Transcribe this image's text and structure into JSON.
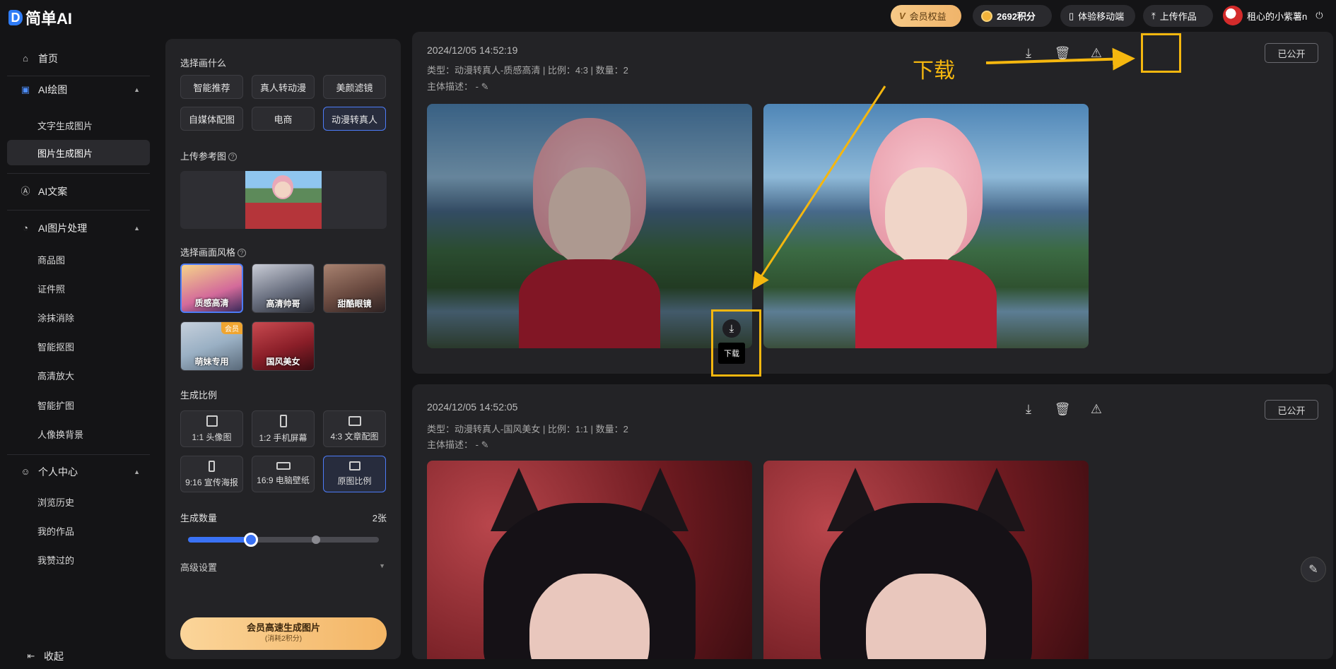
{
  "app": {
    "logo_mark": "D",
    "logo_text": "简单AI"
  },
  "topbar": {
    "vip_icon": "V",
    "vip_label": "会员权益",
    "points": "2692积分",
    "mobile": "体验移动端",
    "upload": "上传作品",
    "username": "租心的小紫薯n",
    "power_icon": "⏻"
  },
  "sidebar": {
    "home": "首页",
    "ai_draw": "AI绘图",
    "text_to_image": "文字生成图片",
    "image_to_image": "图片生成图片",
    "ai_copy": "AI文案",
    "ai_image_process": "AI图片处理",
    "process_items": [
      "商品图",
      "证件照",
      "涂抹消除",
      "智能抠图",
      "高清放大",
      "智能扩图",
      "人像换背景"
    ],
    "personal": "个人中心",
    "personal_items": [
      "浏览历史",
      "我的作品",
      "我赞过的"
    ],
    "collapse": "收起"
  },
  "panel": {
    "choose_title": "选择画什么",
    "categories": [
      "智能推荐",
      "真人转动漫",
      "美颜滤镜",
      "自媒体配图",
      "电商",
      "动漫转真人"
    ],
    "upload_title": "上传参考图",
    "style_title": "选择画面风格",
    "styles": [
      "质感高清",
      "高清帅哥",
      "甜酷眼镜",
      "萌妹专用",
      "国风美女"
    ],
    "member_badge": "会员",
    "ratio_title": "生成比例",
    "ratios": [
      "1:1 头像图",
      "1:2 手机屏幕",
      "4:3 文章配图",
      "9:16 宣传海报",
      "16:9 电脑壁纸",
      "原图比例"
    ],
    "count_title": "生成数量",
    "count_value": "2张",
    "count_progress": 0.33,
    "advanced": "高级设置",
    "generate_label": "会员高速生成图片",
    "generate_cost": "(消耗2积分)"
  },
  "results": [
    {
      "date": "2024/12/05 14:52:19",
      "meta": "类型：动漫转真人-质感高清 | 比例：4:3 | 数量：2",
      "desc": "主体描述：  -",
      "public": "已公开"
    },
    {
      "date": "2024/12/05 14:52:05",
      "meta": "类型：动漫转真人-国风美女 | 比例：1:1 | 数量：2",
      "desc": "主体描述：  -",
      "public": "已公开"
    }
  ],
  "annotation": {
    "label": "下载",
    "tooltip": "下载"
  },
  "colors": {
    "accent": "#4d7cf8",
    "highlight": "#f5b70f",
    "background": "#141416"
  }
}
